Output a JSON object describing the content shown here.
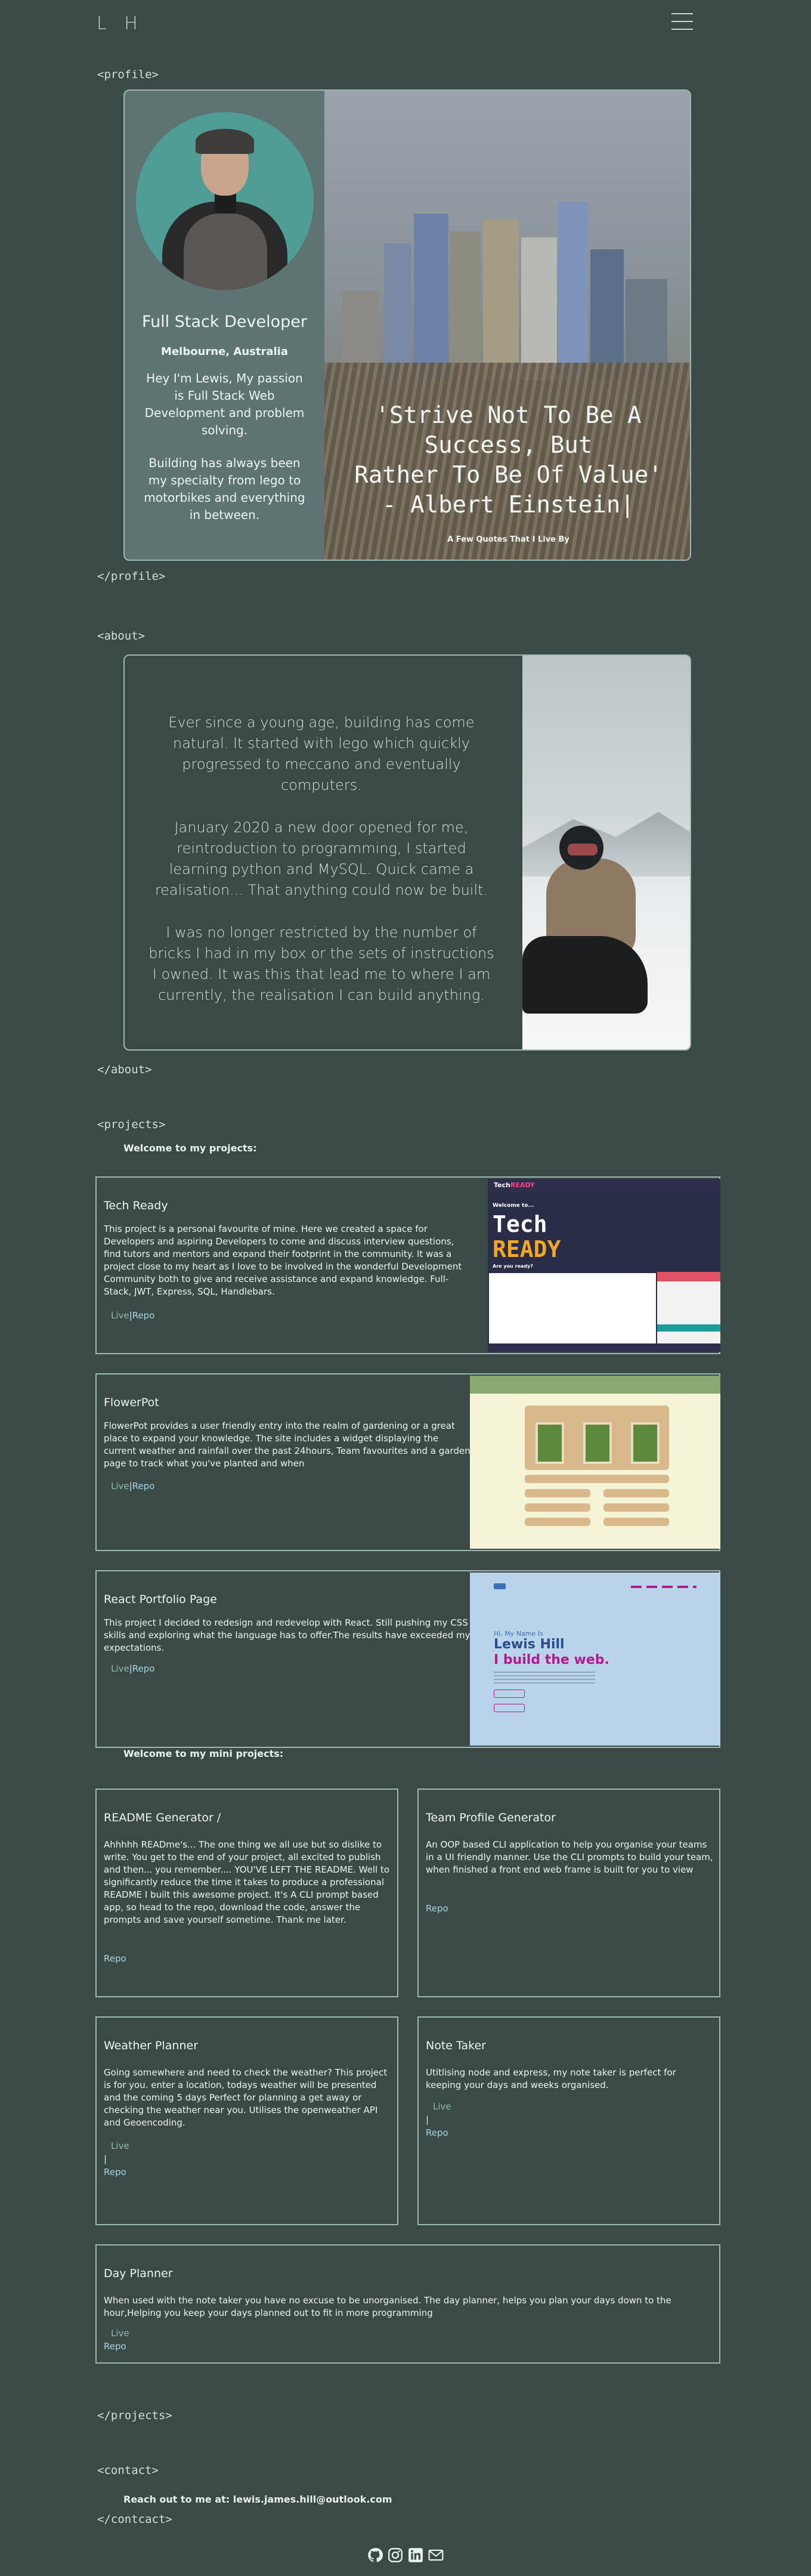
{
  "header": {
    "logo": "L H"
  },
  "profile": {
    "open_tag": "<profile>",
    "close_tag": "</profile>",
    "role": "Full Stack Developer",
    "location": "Melbourne, Australia",
    "intro_1": "Hey I'm Lewis, My passion is Full Stack Web Development and problem solving.",
    "intro_2": "Building has always been my specialty from lego to motorbikes and everything in between.",
    "quote_line1": "'Strive Not To Be A Success, But",
    "quote_line2": "Rather To Be Of Value'",
    "quote_line3": "- Albert Einstein|",
    "quote_caption": "A Few Quotes That I Live By"
  },
  "about": {
    "open_tag": "<about>",
    "close_tag": "</about>",
    "paragraph_1": "Ever since a young age, building has come natural. It started with lego which quickly progressed to meccano and eventually computers.",
    "paragraph_2": "January 2020 a new door opened for me, reintroduction to programming, I started learning python and MySQL. Quick came a realisation... That anything could now be built.",
    "paragraph_3": "I was no longer restricted by the number of bricks I had in my box or the sets of instructions I owned. It was this that lead me to where I am currently, the realisation I can build anything."
  },
  "projects": {
    "open_tag": "<projects>",
    "close_tag": "</projects>",
    "welcome": "Welcome to my projects:",
    "welcome_mini": "Welcome to my mini projects:",
    "live_label": "Live",
    "repo_label": "Repo",
    "separator": "|",
    "items": [
      {
        "title": "Tech Ready",
        "description": "This project is a personal favourite of mine. Here we created a space for Developers and aspiring Developers to come and discuss interview questions, find tutors and mentors and expand their footprint in the community. It was a project close to my heart as I love to be involved in the wonderful Development Community both to give and receive assistance and expand knowledge. Full-Stack, JWT, Express, SQL, Handlebars."
      },
      {
        "title": "FlowerPot",
        "description": "FlowerPot provides a user friendly entry into the realm of gardening or a great place to expand your knowledge. The site includes a widget displaying the current weather and rainfall over the past 24hours, Team favourites and a garden page to track what you've planted and when"
      },
      {
        "title": "React Portfolio Page",
        "description": "This project I decided to redesign and redevelop with React. Still pushing my CSS skills and exploring what the language has to offer.The results have exceeded my expectations."
      }
    ],
    "mini": [
      {
        "title": "README Generator /",
        "description": "Ahhhhh READme's... The one thing we all use but so dislike to write. You get to the end of your project, all excited to publish and then... you remember.... YOU'VE LEFT THE README. Well to significantly reduce the time it takes to produce a professional README I built this awesome project. It's A CLI prompt based app, so head to the repo, download the code, answer the prompts and save yourself sometime. Thank me later."
      },
      {
        "title": "Team Profile Generator",
        "description": "An OOP based CLI application to help you organise your teams in a UI friendly manner. Use the CLI prompts to build your team, when finished a front end web frame is built for you to view"
      },
      {
        "title": "Weather Planner",
        "description": "Going somewhere and need to check the weather? This project is for you. enter a location, todays weather will be presented and the coming 5 days Perfect for planning a get away or checking the weather near you. Utilises the openweather API and Geoencoding."
      },
      {
        "title": "Note Taker",
        "description": "Utitlising node and express, my note taker is perfect for keeping your days and weeks organised."
      },
      {
        "title": "Day Planner",
        "description": "When used with the note taker you have no excuse to be unorganised. The day planner, helps you plan your days down to the hour,Helping you keep your days planned out to fit in more programming"
      }
    ]
  },
  "screenshots": {
    "tech_ready": {
      "logo_a": "Tech",
      "logo_b": "READY",
      "welcome": "Welcome to...",
      "big1": "Tech",
      "big2": "READY",
      "small": "Are you ready?"
    },
    "react_portfolio": {
      "hello": "Hi, My Name Is",
      "name": "Lewis Hill",
      "build": "I build the web."
    }
  },
  "contact": {
    "open_tag": "<contact>",
    "close_tag": "</contcact>",
    "text": "Reach out to me at: lewis.james.hill@outlook.com"
  },
  "social_icons": [
    "github-icon",
    "instagram-icon",
    "linkedin-icon",
    "email-icon"
  ],
  "colors": {
    "background": "#3b4a47",
    "border": "#9fb8b5",
    "link": "#a6d6e3"
  }
}
